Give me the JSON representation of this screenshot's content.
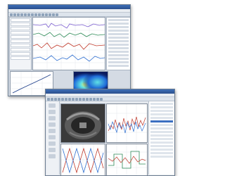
{
  "back_window": {
    "toolbar_buttons": 14,
    "left_panel_rows": 10,
    "right_panel_rows": 14,
    "scope_trace_colors": [
      "#7a5ccf",
      "#2e8b57",
      "#c0392b",
      "#2f6fd0"
    ],
    "spectrum_colors": [
      "#0b1a5c",
      "#1f6ad8",
      "#5fe0e6",
      "#f0f060"
    ]
  },
  "front_window": {
    "toolbar_buttons": 16,
    "nav_items": 9,
    "property_rows": 16,
    "plot_colors": [
      "#c0392b",
      "#2f6fd0",
      "#2e8b57"
    ]
  },
  "accent": "#2a4f8c"
}
